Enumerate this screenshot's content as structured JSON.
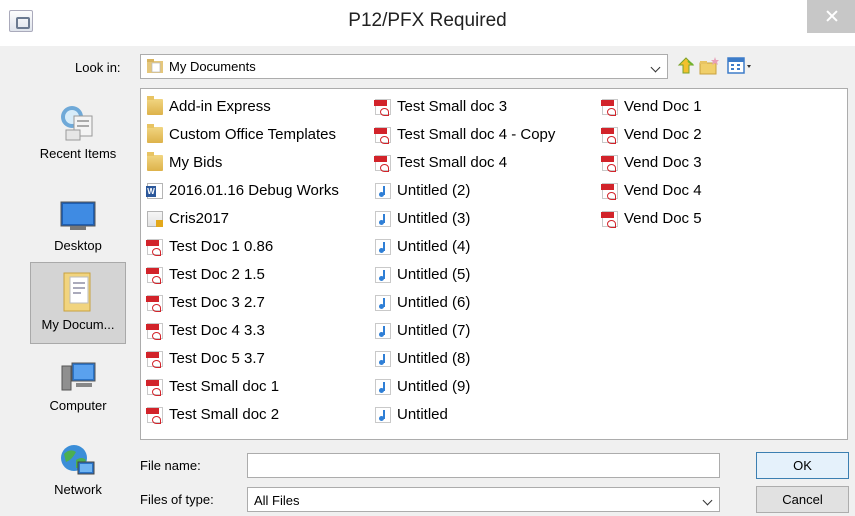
{
  "window": {
    "title": "P12/PFX Required"
  },
  "look_in": {
    "label": "Look in:",
    "value": "My Documents"
  },
  "places": [
    {
      "label": "Recent Items",
      "icon": "recent-items-icon",
      "active": false
    },
    {
      "label": "Desktop",
      "icon": "desktop-icon",
      "active": false
    },
    {
      "label": "My Docum...",
      "icon": "my-documents-icon",
      "active": true
    },
    {
      "label": "Computer",
      "icon": "computer-icon",
      "active": false
    },
    {
      "label": "Network",
      "icon": "network-icon",
      "active": false
    }
  ],
  "files": {
    "column_1": [
      {
        "name": "Add-in Express",
        "type": "folder"
      },
      {
        "name": "Custom Office Templates",
        "type": "folder"
      },
      {
        "name": "My Bids",
        "type": "folder"
      },
      {
        "name": "2016.01.16 Debug Works",
        "type": "word"
      },
      {
        "name": "Cris2017",
        "type": "locked-folder"
      },
      {
        "name": "Test Doc 1 0.86",
        "type": "pdf"
      },
      {
        "name": "Test Doc 2 1.5",
        "type": "pdf"
      },
      {
        "name": "Test Doc 3 2.7",
        "type": "pdf"
      },
      {
        "name": "Test Doc 4 3.3",
        "type": "pdf"
      },
      {
        "name": "Test Doc 5 3.7",
        "type": "pdf"
      },
      {
        "name": "Test Small doc 1",
        "type": "pdf"
      },
      {
        "name": "Test Small doc 2",
        "type": "pdf"
      }
    ],
    "column_2": [
      {
        "name": "Test Small doc 3",
        "type": "pdf"
      },
      {
        "name": "Test Small doc 4 - Copy",
        "type": "pdf"
      },
      {
        "name": "Test Small doc 4",
        "type": "pdf"
      },
      {
        "name": "Untitled (2)",
        "type": "audio"
      },
      {
        "name": "Untitled (3)",
        "type": "audio"
      },
      {
        "name": "Untitled (4)",
        "type": "audio"
      },
      {
        "name": "Untitled (5)",
        "type": "audio"
      },
      {
        "name": "Untitled (6)",
        "type": "audio"
      },
      {
        "name": "Untitled (7)",
        "type": "audio"
      },
      {
        "name": "Untitled (8)",
        "type": "audio"
      },
      {
        "name": "Untitled (9)",
        "type": "audio"
      },
      {
        "name": "Untitled",
        "type": "audio"
      }
    ],
    "column_3": [
      {
        "name": "Vend Doc 1",
        "type": "pdf"
      },
      {
        "name": "Vend Doc 2",
        "type": "pdf"
      },
      {
        "name": "Vend Doc 3",
        "type": "pdf"
      },
      {
        "name": "Vend Doc 4",
        "type": "pdf"
      },
      {
        "name": "Vend Doc 5",
        "type": "pdf"
      }
    ]
  },
  "file_name": {
    "label": "File name:",
    "value": "",
    "placeholder": ""
  },
  "file_type": {
    "label": "Files of type:",
    "value": "All Files"
  },
  "buttons": {
    "ok": "OK",
    "cancel": "Cancel"
  },
  "colors": {
    "accent": "#3c7fb1",
    "pdf_red": "#d2232a",
    "folder_yellow": "#ddb24a"
  }
}
